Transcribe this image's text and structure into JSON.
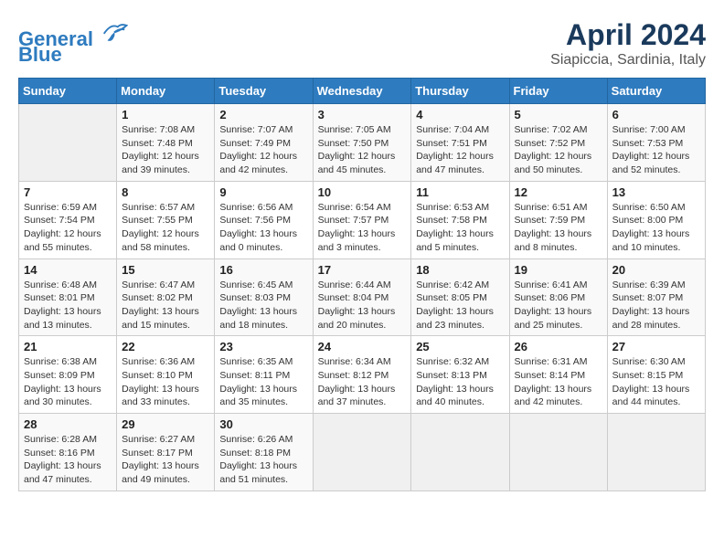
{
  "header": {
    "logo_line1": "General",
    "logo_line2": "Blue",
    "month_title": "April 2024",
    "subtitle": "Siapiccia, Sardinia, Italy"
  },
  "weekdays": [
    "Sunday",
    "Monday",
    "Tuesday",
    "Wednesday",
    "Thursday",
    "Friday",
    "Saturday"
  ],
  "weeks": [
    [
      {
        "day": "",
        "info": ""
      },
      {
        "day": "1",
        "info": "Sunrise: 7:08 AM\nSunset: 7:48 PM\nDaylight: 12 hours\nand 39 minutes."
      },
      {
        "day": "2",
        "info": "Sunrise: 7:07 AM\nSunset: 7:49 PM\nDaylight: 12 hours\nand 42 minutes."
      },
      {
        "day": "3",
        "info": "Sunrise: 7:05 AM\nSunset: 7:50 PM\nDaylight: 12 hours\nand 45 minutes."
      },
      {
        "day": "4",
        "info": "Sunrise: 7:04 AM\nSunset: 7:51 PM\nDaylight: 12 hours\nand 47 minutes."
      },
      {
        "day": "5",
        "info": "Sunrise: 7:02 AM\nSunset: 7:52 PM\nDaylight: 12 hours\nand 50 minutes."
      },
      {
        "day": "6",
        "info": "Sunrise: 7:00 AM\nSunset: 7:53 PM\nDaylight: 12 hours\nand 52 minutes."
      }
    ],
    [
      {
        "day": "7",
        "info": "Sunrise: 6:59 AM\nSunset: 7:54 PM\nDaylight: 12 hours\nand 55 minutes."
      },
      {
        "day": "8",
        "info": "Sunrise: 6:57 AM\nSunset: 7:55 PM\nDaylight: 12 hours\nand 58 minutes."
      },
      {
        "day": "9",
        "info": "Sunrise: 6:56 AM\nSunset: 7:56 PM\nDaylight: 13 hours\nand 0 minutes."
      },
      {
        "day": "10",
        "info": "Sunrise: 6:54 AM\nSunset: 7:57 PM\nDaylight: 13 hours\nand 3 minutes."
      },
      {
        "day": "11",
        "info": "Sunrise: 6:53 AM\nSunset: 7:58 PM\nDaylight: 13 hours\nand 5 minutes."
      },
      {
        "day": "12",
        "info": "Sunrise: 6:51 AM\nSunset: 7:59 PM\nDaylight: 13 hours\nand 8 minutes."
      },
      {
        "day": "13",
        "info": "Sunrise: 6:50 AM\nSunset: 8:00 PM\nDaylight: 13 hours\nand 10 minutes."
      }
    ],
    [
      {
        "day": "14",
        "info": "Sunrise: 6:48 AM\nSunset: 8:01 PM\nDaylight: 13 hours\nand 13 minutes."
      },
      {
        "day": "15",
        "info": "Sunrise: 6:47 AM\nSunset: 8:02 PM\nDaylight: 13 hours\nand 15 minutes."
      },
      {
        "day": "16",
        "info": "Sunrise: 6:45 AM\nSunset: 8:03 PM\nDaylight: 13 hours\nand 18 minutes."
      },
      {
        "day": "17",
        "info": "Sunrise: 6:44 AM\nSunset: 8:04 PM\nDaylight: 13 hours\nand 20 minutes."
      },
      {
        "day": "18",
        "info": "Sunrise: 6:42 AM\nSunset: 8:05 PM\nDaylight: 13 hours\nand 23 minutes."
      },
      {
        "day": "19",
        "info": "Sunrise: 6:41 AM\nSunset: 8:06 PM\nDaylight: 13 hours\nand 25 minutes."
      },
      {
        "day": "20",
        "info": "Sunrise: 6:39 AM\nSunset: 8:07 PM\nDaylight: 13 hours\nand 28 minutes."
      }
    ],
    [
      {
        "day": "21",
        "info": "Sunrise: 6:38 AM\nSunset: 8:09 PM\nDaylight: 13 hours\nand 30 minutes."
      },
      {
        "day": "22",
        "info": "Sunrise: 6:36 AM\nSunset: 8:10 PM\nDaylight: 13 hours\nand 33 minutes."
      },
      {
        "day": "23",
        "info": "Sunrise: 6:35 AM\nSunset: 8:11 PM\nDaylight: 13 hours\nand 35 minutes."
      },
      {
        "day": "24",
        "info": "Sunrise: 6:34 AM\nSunset: 8:12 PM\nDaylight: 13 hours\nand 37 minutes."
      },
      {
        "day": "25",
        "info": "Sunrise: 6:32 AM\nSunset: 8:13 PM\nDaylight: 13 hours\nand 40 minutes."
      },
      {
        "day": "26",
        "info": "Sunrise: 6:31 AM\nSunset: 8:14 PM\nDaylight: 13 hours\nand 42 minutes."
      },
      {
        "day": "27",
        "info": "Sunrise: 6:30 AM\nSunset: 8:15 PM\nDaylight: 13 hours\nand 44 minutes."
      }
    ],
    [
      {
        "day": "28",
        "info": "Sunrise: 6:28 AM\nSunset: 8:16 PM\nDaylight: 13 hours\nand 47 minutes."
      },
      {
        "day": "29",
        "info": "Sunrise: 6:27 AM\nSunset: 8:17 PM\nDaylight: 13 hours\nand 49 minutes."
      },
      {
        "day": "30",
        "info": "Sunrise: 6:26 AM\nSunset: 8:18 PM\nDaylight: 13 hours\nand 51 minutes."
      },
      {
        "day": "",
        "info": ""
      },
      {
        "day": "",
        "info": ""
      },
      {
        "day": "",
        "info": ""
      },
      {
        "day": "",
        "info": ""
      }
    ]
  ]
}
